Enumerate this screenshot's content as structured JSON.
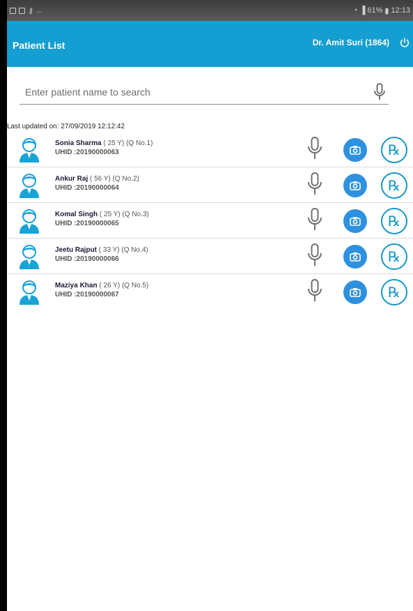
{
  "status_bar": {
    "left_text": "...",
    "right_text": "61%",
    "time": "12:13"
  },
  "app_bar": {
    "title": "Patient List",
    "doctor": "Dr. Amit Suri (1864)"
  },
  "search": {
    "placeholder": "Enter patient name to search",
    "value": ""
  },
  "last_updated": "Last updated on: 27/09/2019 12:12:42",
  "patients": [
    {
      "name": "Sonia Sharma",
      "meta": " ( 25 Y) (Q No.1)",
      "uhid": "UHID :20190000063",
      "gender": "female"
    },
    {
      "name": "Ankur Raj",
      "meta": " ( 56 Y) (Q No.2)",
      "uhid": "UHID :20190000064",
      "gender": "male"
    },
    {
      "name": "Komal Singh",
      "meta": " ( 25 Y) (Q No.3)",
      "uhid": "UHID :20190000065",
      "gender": "female"
    },
    {
      "name": "Jeetu Rajput",
      "meta": " ( 33 Y) (Q No.4)",
      "uhid": "UHID :20190000066",
      "gender": "male"
    },
    {
      "name": "Maziya Khan",
      "meta": " ( 26 Y) (Q No.5)",
      "uhid": "UHID :20190000067",
      "gender": "female"
    }
  ],
  "icons": {
    "mic": "mic-icon",
    "camera": "camera-icon",
    "rx": "rx-icon",
    "power": "power-icon"
  },
  "colors": {
    "accent": "#149ed1",
    "camera": "#2d91e0",
    "rx": "#1596c8"
  }
}
